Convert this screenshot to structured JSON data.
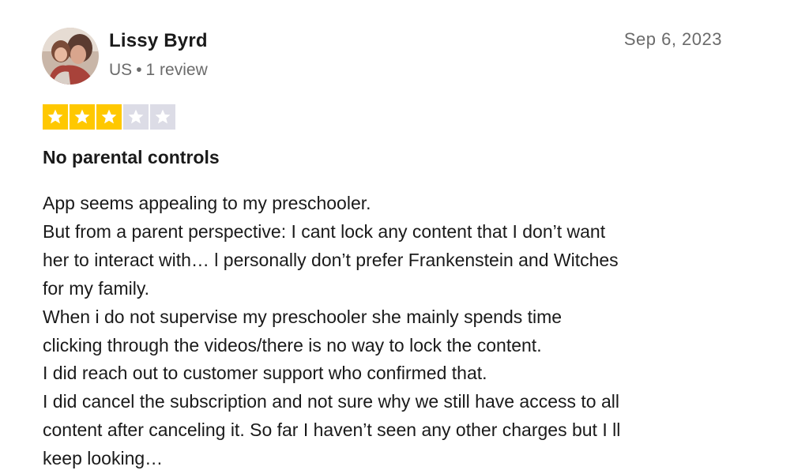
{
  "reviewer": {
    "name": "Lissy Byrd",
    "country": "US",
    "separator": "•",
    "review_count": "1 review"
  },
  "review": {
    "date": "Sep 6, 2023",
    "rating": 3,
    "max_rating": 5,
    "title": "No parental controls",
    "body_lines": [
      "App seems appealing to my preschooler.",
      "But from a parent perspective: I cant lock any content that I don’t want",
      "her to interact with… l personally don’t prefer Frankenstein and Witches",
      "for my family.",
      "When i do not supervise my preschooler she mainly spends time",
      "clicking through the videos/there is no way to lock the content.",
      "I did reach out to customer support who confirmed that.",
      "I did cancel the subscription and not sure why we still have access to all",
      "content after canceling it. So far I haven’t seen any other charges but I ll",
      "keep looking…"
    ]
  },
  "colors": {
    "star_filled": "#ffc800",
    "star_empty": "#dcdce6",
    "text_primary": "#1a1a1a",
    "text_muted": "#6b6b6b"
  },
  "icons": {
    "avatar": "reviewer-avatar-photo",
    "star": "star-icon"
  }
}
